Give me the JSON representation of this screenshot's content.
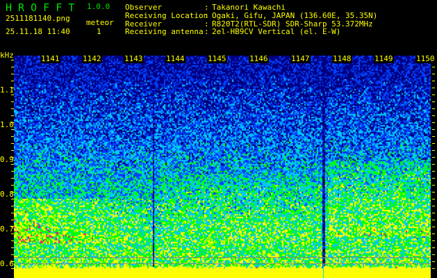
{
  "header": {
    "app_name": "H R O F F T",
    "version": "1.0.0",
    "filename": "2511181140.png",
    "datetime": "25.11.18 11:40",
    "meteor_label": "meteor",
    "meteor_count": "1"
  },
  "info": [
    {
      "label": "Observer",
      "value": "Takanori Kawachi"
    },
    {
      "label": "Receiving Location",
      "value": "Ogaki, Gifu, JAPAN (136.60E, 35.35N)"
    },
    {
      "label": "Receiver",
      "value": "R820T2(RTL-SDR) SDR-Sharp 53.372MHz"
    },
    {
      "label": "Receiving antenna",
      "value": "2el-HB9CV Vertical (el. E-W)"
    }
  ],
  "spectrogram": {
    "y_unit": "kHz",
    "y_ticks": [
      "1.1",
      "1.0",
      "0.9",
      "0.8",
      "0.7",
      "0.6"
    ],
    "time_labels": [
      "1141",
      "1142",
      "1143",
      "1144",
      "1145",
      "1146",
      "1147",
      "1148",
      "1149",
      "1150"
    ],
    "colors": {
      "low": "#000080",
      "blue": "#0040ff",
      "cyan": "#00c8ff",
      "green": "#00ff00",
      "yellow": "#ffff00",
      "high": "#ff0080",
      "baseline": "#ffff00"
    }
  }
}
